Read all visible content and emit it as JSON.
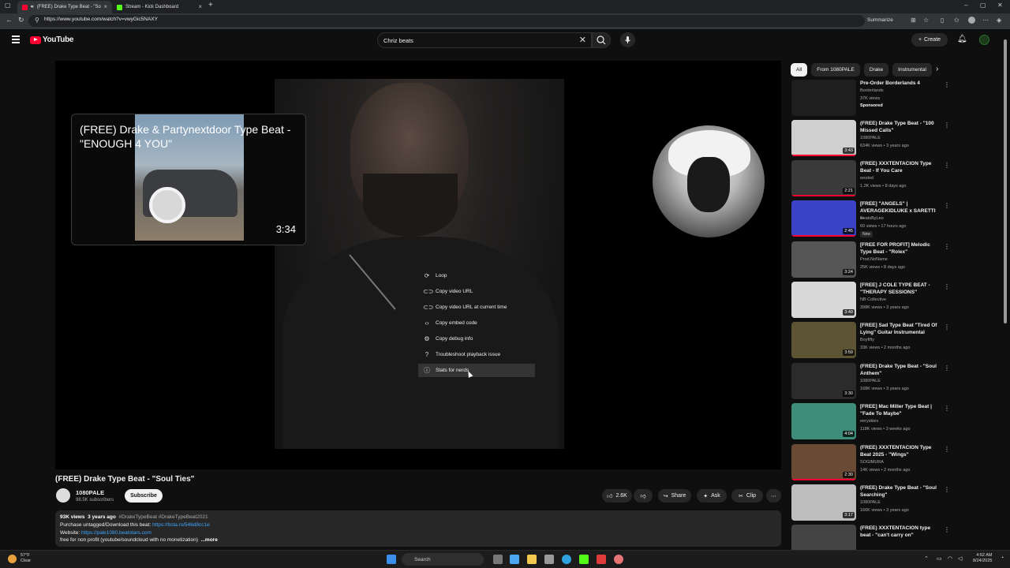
{
  "browser": {
    "tabs": [
      {
        "label": "(FREE) Drake Type Beat - \"So",
        "active": true
      },
      {
        "label": "Stream - Kick Dashboard",
        "active": false
      }
    ],
    "url": "https://www.youtube.com/watch?v=vwyGic5NAXY",
    "summarize_label": "Summarize"
  },
  "masthead": {
    "logo_text": "YouTube",
    "search_query": "Chriz beats",
    "create_label": "Create"
  },
  "player": {
    "preview": {
      "title": "(FREE) Drake & Partynextdoor Type Beat - \"ENOUGH 4 YOU\"",
      "duration": "3:34"
    },
    "context_menu": [
      {
        "label": "Loop",
        "icon": "loop-icon"
      },
      {
        "label": "Copy video URL",
        "icon": "link-icon"
      },
      {
        "label": "Copy video URL at current time",
        "icon": "link-icon"
      },
      {
        "label": "Copy embed code",
        "icon": "code-icon"
      },
      {
        "label": "Copy debug info",
        "icon": "bug-icon"
      },
      {
        "label": "Troubleshoot playback issue",
        "icon": "help-icon"
      },
      {
        "label": "Stats for nerds",
        "icon": "info-icon"
      }
    ]
  },
  "video": {
    "title": "(FREE) Drake Type Beat - \"Soul Ties\"",
    "channel_name": "1080PALE",
    "channel_subs": "98.5K subscribers",
    "subscribe_label": "Subscribe",
    "likes": "2.6K",
    "share_label": "Share",
    "ask_label": "Ask",
    "clip_label": "Clip"
  },
  "description": {
    "views": "93K views",
    "age": "3 years ago",
    "tags": "#DrakeTypeBeat #DrakeTypeBeat2021",
    "line2_text": "Purchase untagged/Download this beat: ",
    "line2_link": "https://bsta.rs/546d8cc1e",
    "line3_text": "Website: ",
    "line3_link": "https://pale1080.beatstars.com",
    "line4_text": "free for non profit (youtube/soundcloud with no monetization)",
    "more_label": "...more"
  },
  "sidebar": {
    "chips": [
      "All",
      "From 1080PALE",
      "Drake",
      "Instrumental"
    ],
    "items": [
      {
        "title": "Pre-Order Borderlands 4",
        "channel": "Borderlands",
        "meta": "37K views",
        "extra": "Sponsored",
        "duration": "",
        "thumb_color": "#1a1a1a"
      },
      {
        "title": "(FREE) Drake Type Beat - \"100 Missed Calls\"",
        "channel": "1080PALE",
        "meta": "634K views • 3 years ago",
        "extra": "",
        "duration": "3:43",
        "thumb_color": "#cfcfcf"
      },
      {
        "title": "(FREE) XXXTENTACION Type Beat - If You Care",
        "channel": "wxsted",
        "meta": "1.2K views • 8 days ago",
        "extra": "",
        "duration": "2:21",
        "thumb_color": "#3a3a3a"
      },
      {
        "title": "[FREE] \"ANGELS\" | AVERAGEKIDLUKE x SARETTI ...",
        "channel": "BeatsByLeo",
        "meta": "60 views • 17 hours ago",
        "extra": "New",
        "duration": "2:45",
        "thumb_color": "#3b43c9"
      },
      {
        "title": "[FREE FOR PROFIT] Melodic Type Beat - \"Rolex\"",
        "channel": "Prod.NoName",
        "meta": "25K views • 8 days ago",
        "extra": "",
        "duration": "3:24",
        "thumb_color": "#555555"
      },
      {
        "title": "[FREE] J COLE TYPE BEAT - \"THERAPY SESSIONS\"",
        "channel": "NB Collective",
        "meta": "398K views • 3 years ago",
        "extra": "",
        "duration": "3:49",
        "thumb_color": "#d8d8d8"
      },
      {
        "title": "[FREE] Sad Type Beat \"Tired Of Lying\" Guitar Instrumental",
        "channel": "Boyfifty",
        "meta": "33K views • 2 months ago",
        "extra": "",
        "duration": "3:59",
        "thumb_color": "#5c5432"
      },
      {
        "title": "(FREE) Drake Type Beat - \"Soul Anthem\"",
        "channel": "1080PALE",
        "meta": "168K views • 3 years ago",
        "extra": "",
        "duration": "3:30",
        "thumb_color": "#2b2b2b"
      },
      {
        "title": "[FREE] Mac Miller Type Beat | \"Fade To Maybe\"",
        "channel": "eeryskies",
        "meta": "118K views • 3 weeks ago",
        "extra": "",
        "duration": "4:04",
        "thumb_color": "#3d8d7a"
      },
      {
        "title": "(FREE) XXXTENTACION Type Beat 2025 - \"Wings\"",
        "channel": "SOGIMURA",
        "meta": "14K views • 2 months ago",
        "extra": "",
        "duration": "2:30",
        "thumb_color": "#6b4a35"
      },
      {
        "title": "(FREE) Drake Type Beat - \"Soul Searching\"",
        "channel": "1080PALE",
        "meta": "166K views • 3 years ago",
        "extra": "",
        "duration": "3:17",
        "thumb_color": "#bdbdbd"
      },
      {
        "title": "(FREE) XXXTENTACION type beat - \"can't carry on\"",
        "channel": "",
        "meta": "",
        "extra": "",
        "duration": "",
        "thumb_color": "#444444"
      }
    ]
  },
  "taskbar": {
    "weather_temp": "57°F",
    "weather_cond": "Clear",
    "search_placeholder": "Search",
    "time": "4:52 AM",
    "date": "8/24/2025"
  }
}
